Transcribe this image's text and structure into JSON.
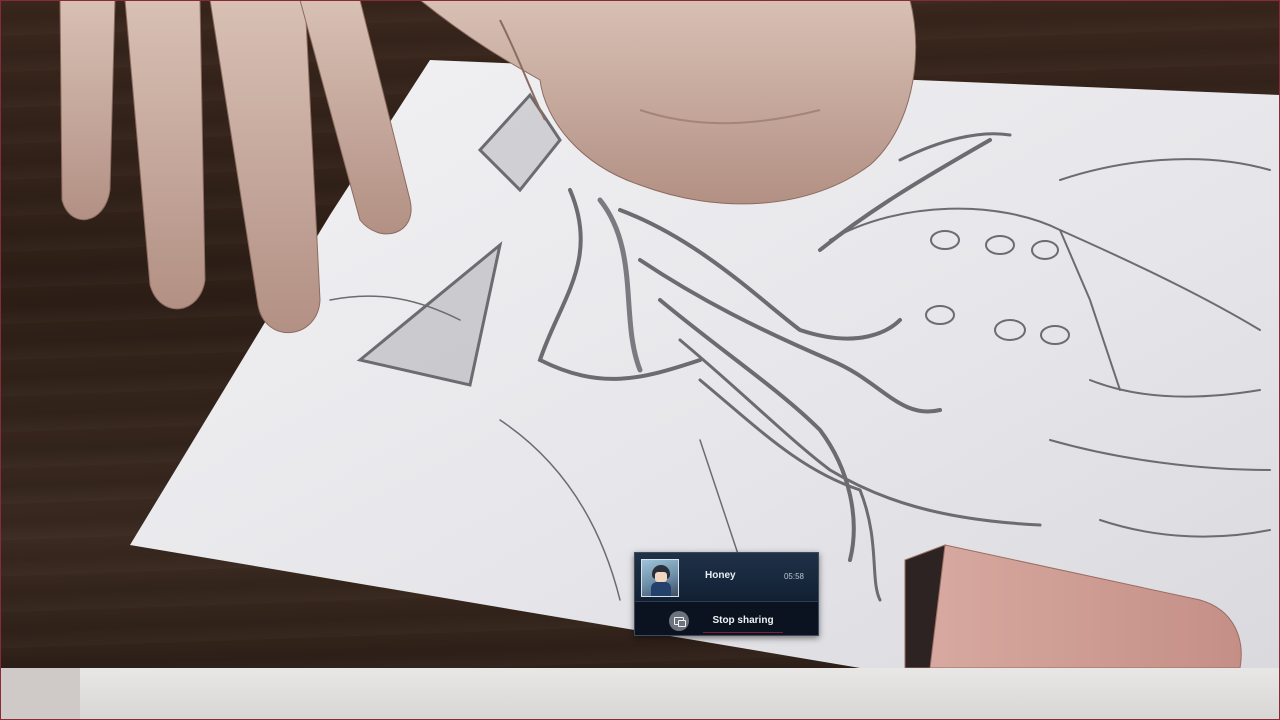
{
  "share_overlay": {
    "user_name": "Honey",
    "duration": "05:58",
    "stop_label": "Stop sharing",
    "avatar_icon": "user-avatar-icon",
    "stop_icon": "stop-share-icon"
  },
  "colors": {
    "overlay_bg": "#0b1320",
    "overlay_header": "#1f3147",
    "frame_border": "#8a2a36"
  }
}
